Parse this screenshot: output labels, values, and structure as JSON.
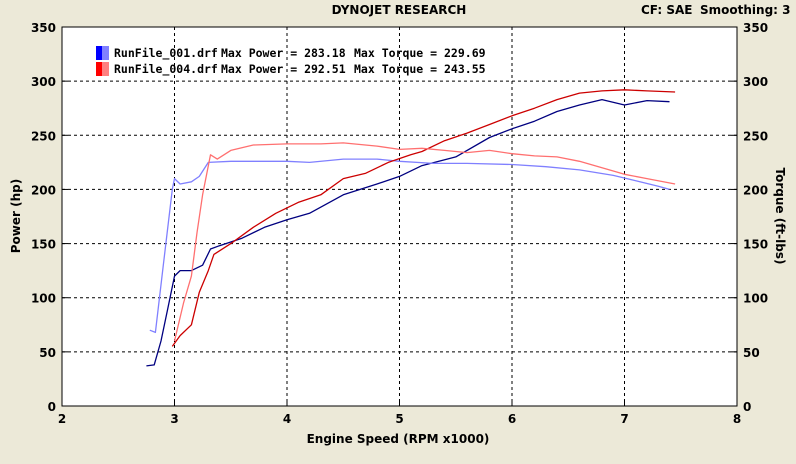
{
  "header": {
    "title": "DYNOJET RESEARCH",
    "cf_label": "CF: SAE",
    "smoothing_label": "Smoothing: 3"
  },
  "legend": [
    {
      "file": "RunFile_001.drf",
      "max_power": "Max Power = 283.18",
      "max_torque": "Max Torque = 229.69",
      "color": "#0000ff"
    },
    {
      "file": "RunFile_004.drf",
      "max_power": "Max Power = 292.51",
      "max_torque": "Max Torque = 243.55",
      "color": "#ff0000"
    }
  ],
  "chart_data": {
    "type": "line",
    "xlabel": "Engine Speed (RPM x1000)",
    "ylabel": "Power (hp)",
    "y2label": "Torque (ft-lbs)",
    "xlim": [
      2,
      8
    ],
    "ylim": [
      0,
      350
    ],
    "y2lim": [
      0,
      350
    ],
    "x_ticks": [
      "2",
      "3",
      "4",
      "5",
      "6",
      "7",
      "8"
    ],
    "y_ticks": [
      "0",
      "50",
      "100",
      "150",
      "200",
      "250",
      "300",
      "350"
    ],
    "grid": true,
    "legend_position": "top-left",
    "series": [
      {
        "name": "RunFile_001.drf",
        "measure": "power",
        "color": "#000080",
        "points": [
          [
            2.75,
            37
          ],
          [
            2.82,
            38
          ],
          [
            2.88,
            60
          ],
          [
            2.94,
            90
          ],
          [
            3.0,
            120
          ],
          [
            3.05,
            125
          ],
          [
            3.15,
            125
          ],
          [
            3.25,
            130
          ],
          [
            3.32,
            145
          ],
          [
            3.4,
            148
          ],
          [
            3.6,
            155
          ],
          [
            3.8,
            165
          ],
          [
            4.0,
            172
          ],
          [
            4.2,
            178
          ],
          [
            4.5,
            195
          ],
          [
            4.8,
            205
          ],
          [
            5.0,
            212
          ],
          [
            5.2,
            222
          ],
          [
            5.5,
            230
          ],
          [
            5.8,
            248
          ],
          [
            6.0,
            256
          ],
          [
            6.2,
            263
          ],
          [
            6.4,
            272
          ],
          [
            6.6,
            278
          ],
          [
            6.8,
            283
          ],
          [
            7.0,
            278
          ],
          [
            7.2,
            282
          ],
          [
            7.4,
            281
          ]
        ]
      },
      {
        "name": "RunFile_001.drf",
        "measure": "torque",
        "color": "#8080ff",
        "points": [
          [
            2.78,
            70
          ],
          [
            2.83,
            68
          ],
          [
            2.9,
            130
          ],
          [
            2.98,
            200
          ],
          [
            3.0,
            210
          ],
          [
            3.05,
            205
          ],
          [
            3.15,
            207
          ],
          [
            3.22,
            212
          ],
          [
            3.3,
            225
          ],
          [
            3.5,
            226
          ],
          [
            3.8,
            226
          ],
          [
            4.0,
            226
          ],
          [
            4.2,
            225
          ],
          [
            4.5,
            228
          ],
          [
            4.8,
            228
          ],
          [
            5.0,
            226
          ],
          [
            5.3,
            224
          ],
          [
            5.6,
            224
          ],
          [
            6.0,
            223
          ],
          [
            6.3,
            221
          ],
          [
            6.6,
            218
          ],
          [
            6.9,
            213
          ],
          [
            7.1,
            208
          ],
          [
            7.3,
            203
          ],
          [
            7.4,
            200
          ]
        ]
      },
      {
        "name": "RunFile_004.drf",
        "measure": "power",
        "color": "#cc0000",
        "points": [
          [
            2.98,
            55
          ],
          [
            3.05,
            65
          ],
          [
            3.15,
            75
          ],
          [
            3.22,
            105
          ],
          [
            3.3,
            125
          ],
          [
            3.35,
            140
          ],
          [
            3.5,
            150
          ],
          [
            3.7,
            165
          ],
          [
            3.9,
            178
          ],
          [
            4.1,
            188
          ],
          [
            4.3,
            195
          ],
          [
            4.5,
            210
          ],
          [
            4.7,
            215
          ],
          [
            4.9,
            225
          ],
          [
            5.1,
            232
          ],
          [
            5.2,
            235
          ],
          [
            5.4,
            245
          ],
          [
            5.6,
            252
          ],
          [
            5.8,
            260
          ],
          [
            6.0,
            268
          ],
          [
            6.2,
            275
          ],
          [
            6.4,
            283
          ],
          [
            6.6,
            289
          ],
          [
            6.8,
            291
          ],
          [
            7.0,
            292
          ],
          [
            7.2,
            291
          ],
          [
            7.45,
            290
          ]
        ]
      },
      {
        "name": "RunFile_004.drf",
        "measure": "torque",
        "color": "#ff7070",
        "points": [
          [
            3.0,
            60
          ],
          [
            3.08,
            95
          ],
          [
            3.15,
            120
          ],
          [
            3.2,
            160
          ],
          [
            3.25,
            195
          ],
          [
            3.32,
            232
          ],
          [
            3.38,
            228
          ],
          [
            3.5,
            236
          ],
          [
            3.7,
            241
          ],
          [
            4.0,
            242
          ],
          [
            4.3,
            242
          ],
          [
            4.5,
            243
          ],
          [
            4.8,
            240
          ],
          [
            5.0,
            237
          ],
          [
            5.2,
            238
          ],
          [
            5.4,
            236
          ],
          [
            5.6,
            234
          ],
          [
            5.8,
            236
          ],
          [
            6.0,
            233
          ],
          [
            6.2,
            231
          ],
          [
            6.4,
            230
          ],
          [
            6.6,
            226
          ],
          [
            6.8,
            220
          ],
          [
            7.0,
            214
          ],
          [
            7.2,
            210
          ],
          [
            7.45,
            205
          ]
        ]
      }
    ]
  }
}
